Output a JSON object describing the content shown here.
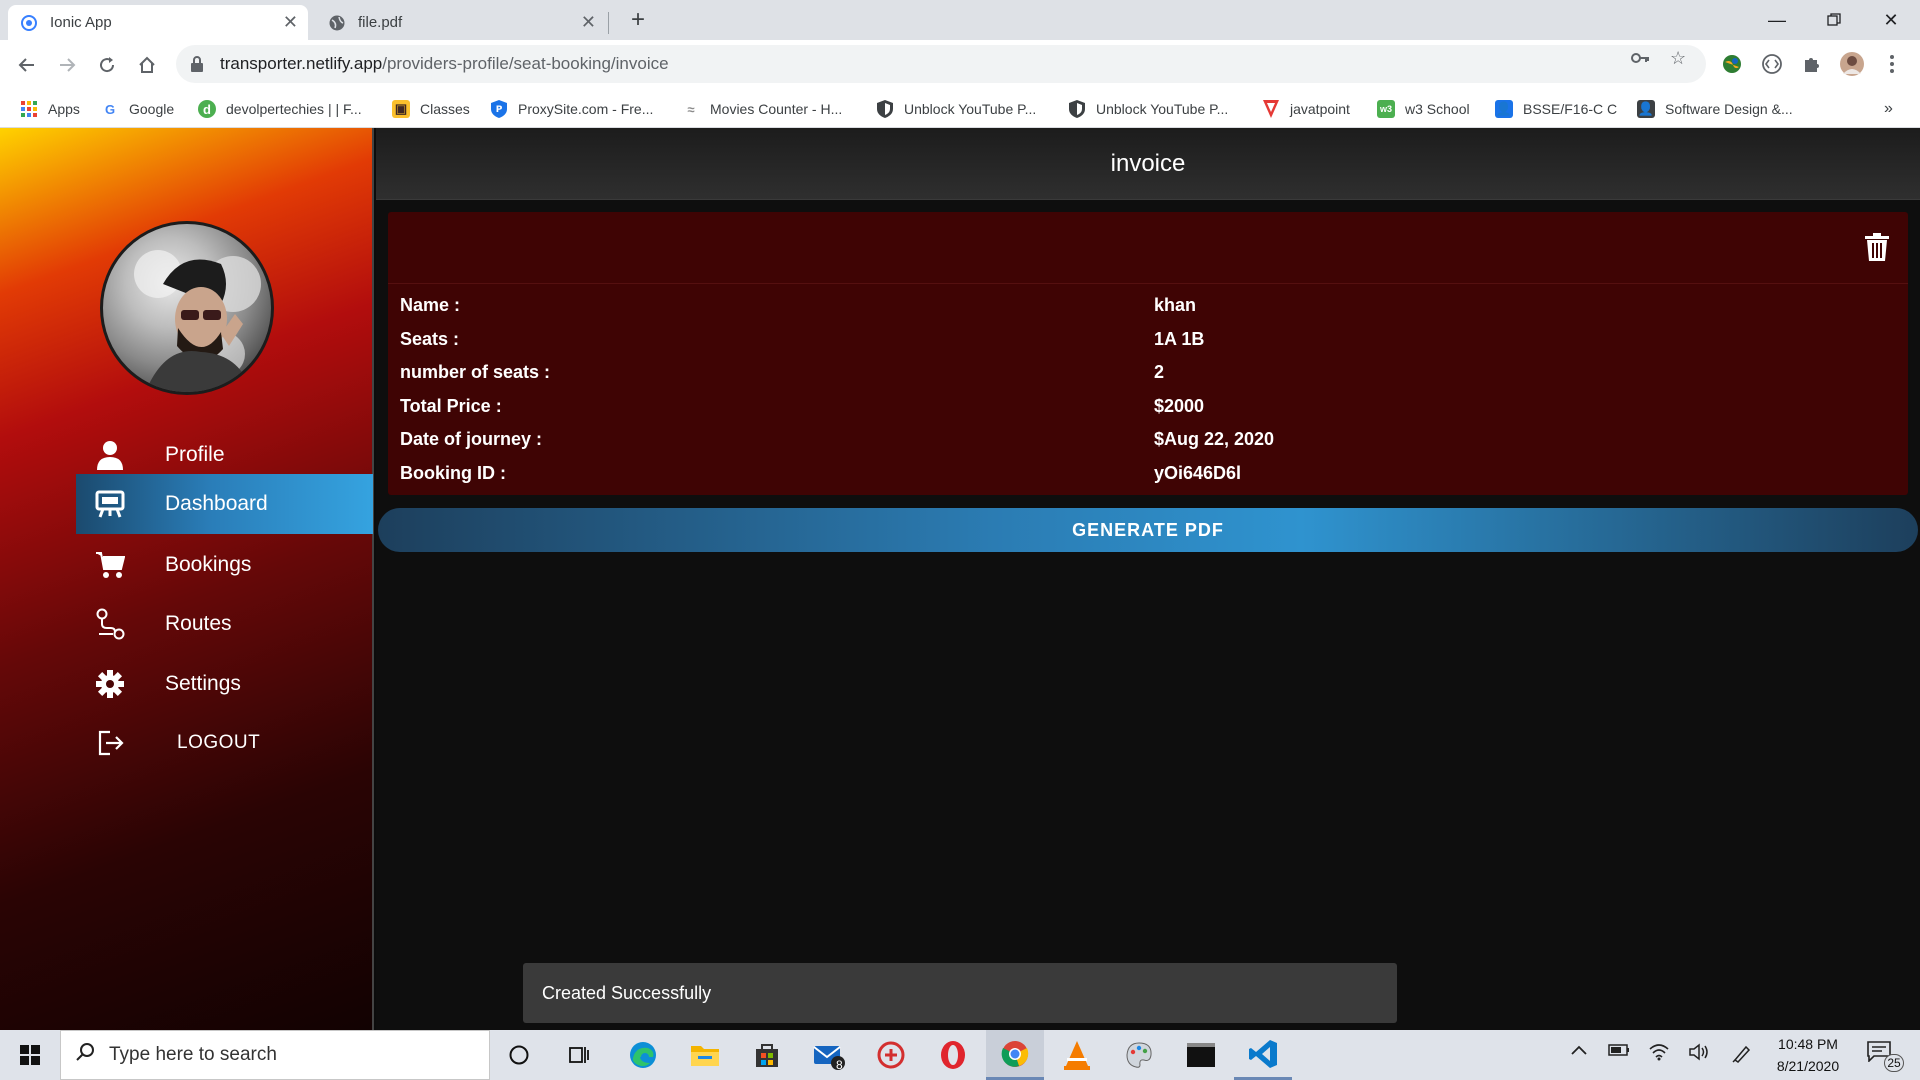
{
  "browser": {
    "tabs": [
      {
        "title": "Ionic App",
        "active": true
      },
      {
        "title": "file.pdf",
        "active": false
      }
    ],
    "url": {
      "host": "transporter.netlify.app",
      "path": "/providers-profile/seat-booking/invoice"
    },
    "bookmarks": [
      {
        "label": "Apps",
        "icon": "apps-grid-icon"
      },
      {
        "label": "Google",
        "icon": "google-icon"
      },
      {
        "label": "devolpertechies | | F...",
        "icon": "devolpertechies-icon"
      },
      {
        "label": "Classes",
        "icon": "classes-icon"
      },
      {
        "label": "ProxySite.com - Fre...",
        "icon": "proxysite-icon"
      },
      {
        "label": "Movies Counter - H...",
        "icon": "movies-counter-icon"
      },
      {
        "label": "Unblock YouTube P...",
        "icon": "shield-icon"
      },
      {
        "label": "Unblock YouTube P...",
        "icon": "shield-icon"
      },
      {
        "label": "javatpoint",
        "icon": "javatpoint-icon"
      },
      {
        "label": "w3 School",
        "icon": "w3school-icon"
      },
      {
        "label": "BSSE/F16-C C",
        "icon": "contacts-icon"
      },
      {
        "label": "Software Design &...",
        "icon": "contacts-icon"
      }
    ],
    "more_bookmarks": "»"
  },
  "app": {
    "page_title": "invoice",
    "menu": [
      {
        "label": "Profile",
        "icon": "person-icon",
        "active": false
      },
      {
        "label": "Dashboard",
        "icon": "easel-icon",
        "active": true
      },
      {
        "label": "Bookings",
        "icon": "cart-icon",
        "active": false
      },
      {
        "label": "Routes",
        "icon": "route-icon",
        "active": false
      },
      {
        "label": "Settings",
        "icon": "gear-icon",
        "active": false
      }
    ],
    "logout_label": "LOGOUT",
    "invoice": {
      "rows": [
        {
          "label": "Name :",
          "value": "khan"
        },
        {
          "label": "Seats :",
          "value": "1A 1B"
        },
        {
          "label": "number of seats :",
          "value": "2"
        },
        {
          "label": "Total Price :",
          "value": "$2000"
        },
        {
          "label": "Date of journey :",
          "value": "$Aug 22, 2020"
        },
        {
          "label": "Booking ID :",
          "value": "yOi646D6l"
        }
      ]
    },
    "generate_button": "GENERATE PDF",
    "toast": "Created Successfully"
  },
  "taskbar": {
    "search_placeholder": "Type here to search",
    "time": "10:48 PM",
    "date": "8/21/2020",
    "mail_badge": "8",
    "notification_count": "25"
  },
  "colors": {
    "accent_blue": "#2f93cf",
    "invoice_card": "#3f0404",
    "sidebar_top": "#ffd200",
    "sidebar_bottom": "#120202"
  }
}
